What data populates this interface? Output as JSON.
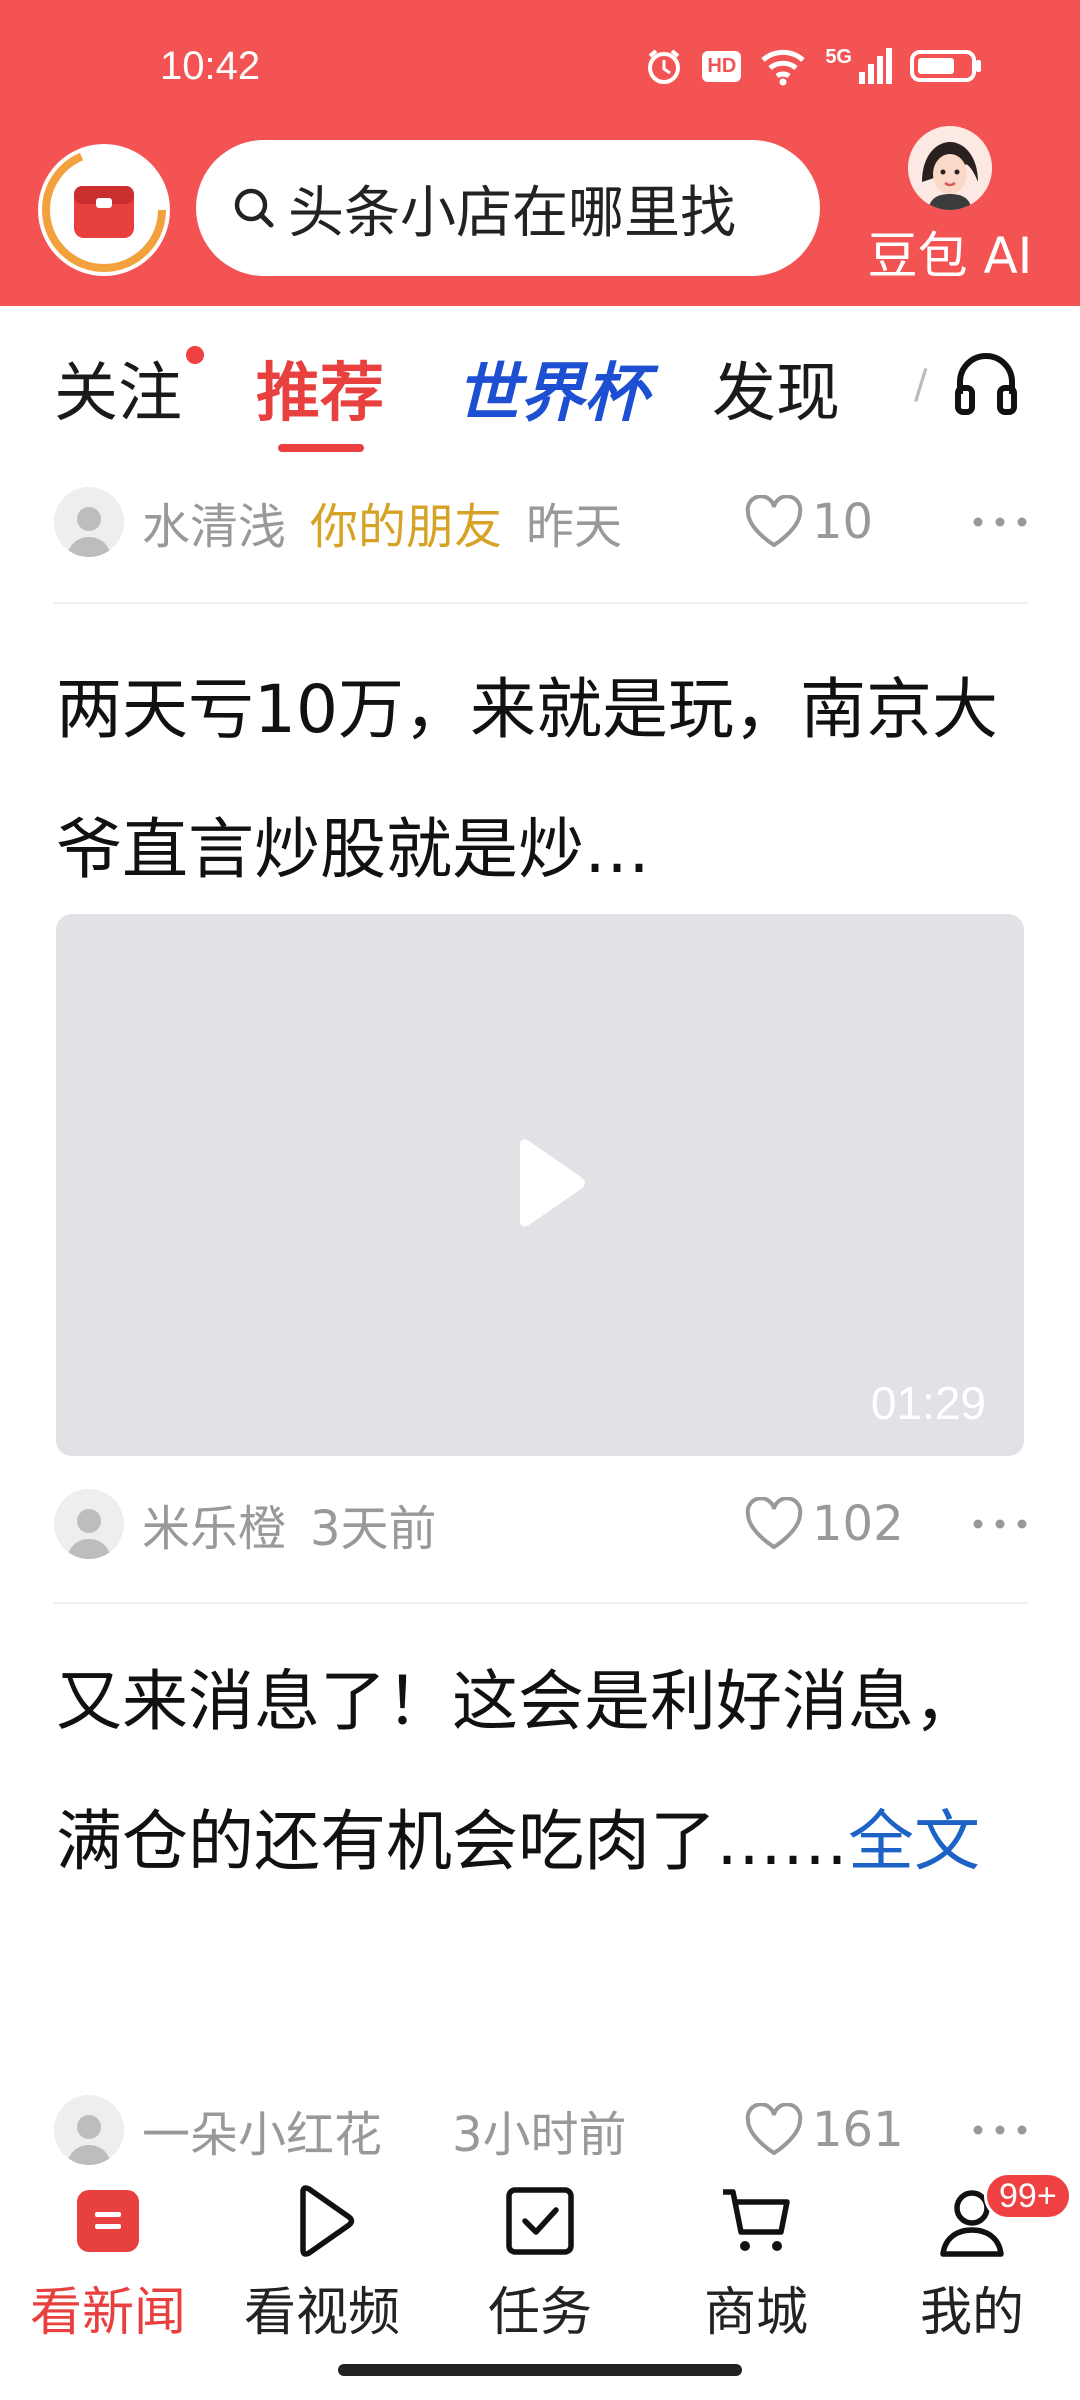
{
  "status_bar": {
    "time": "10:42",
    "hd": "HD",
    "network": "5G"
  },
  "header": {
    "search_placeholder": "头条小店在哪里找",
    "ai_label": "豆包 AI",
    "colors": {
      "header_bg": "#f35353"
    }
  },
  "tabs": {
    "follow": "关注",
    "recommend": "推荐",
    "world_cup": "世界杯",
    "discover": "发现",
    "more": "/"
  },
  "feed": {
    "post1_meta": {
      "author": "水清浅",
      "tag": "你的朋友",
      "time": "昨天",
      "likes": "10"
    },
    "post2": {
      "title": "两天亏10万，来就是玩，南京大爷直言炒股就是炒…",
      "duration": "01:29",
      "author": "米乐橙",
      "time": "3天前",
      "likes": "102"
    },
    "post3": {
      "title": "又来消息了！这会是利好消息，满仓的还有机会吃肉了……",
      "full_text_link": "全文",
      "author": "一朵小红花",
      "time": "3小时前",
      "likes": "161"
    }
  },
  "bottom_nav": {
    "items": [
      {
        "label": "看新闻",
        "icon": "news-icon",
        "active": true
      },
      {
        "label": "看视频",
        "icon": "play-icon",
        "active": false
      },
      {
        "label": "任务",
        "icon": "task-icon",
        "active": false
      },
      {
        "label": "商城",
        "icon": "cart-icon",
        "active": false
      },
      {
        "label": "我的",
        "icon": "user-icon",
        "active": false,
        "badge": "99+"
      }
    ]
  },
  "colors": {
    "accent": "#e8403e",
    "link": "#1d63c7",
    "friend_tag": "#d6a326",
    "world_cup": "#1c4fd2"
  }
}
